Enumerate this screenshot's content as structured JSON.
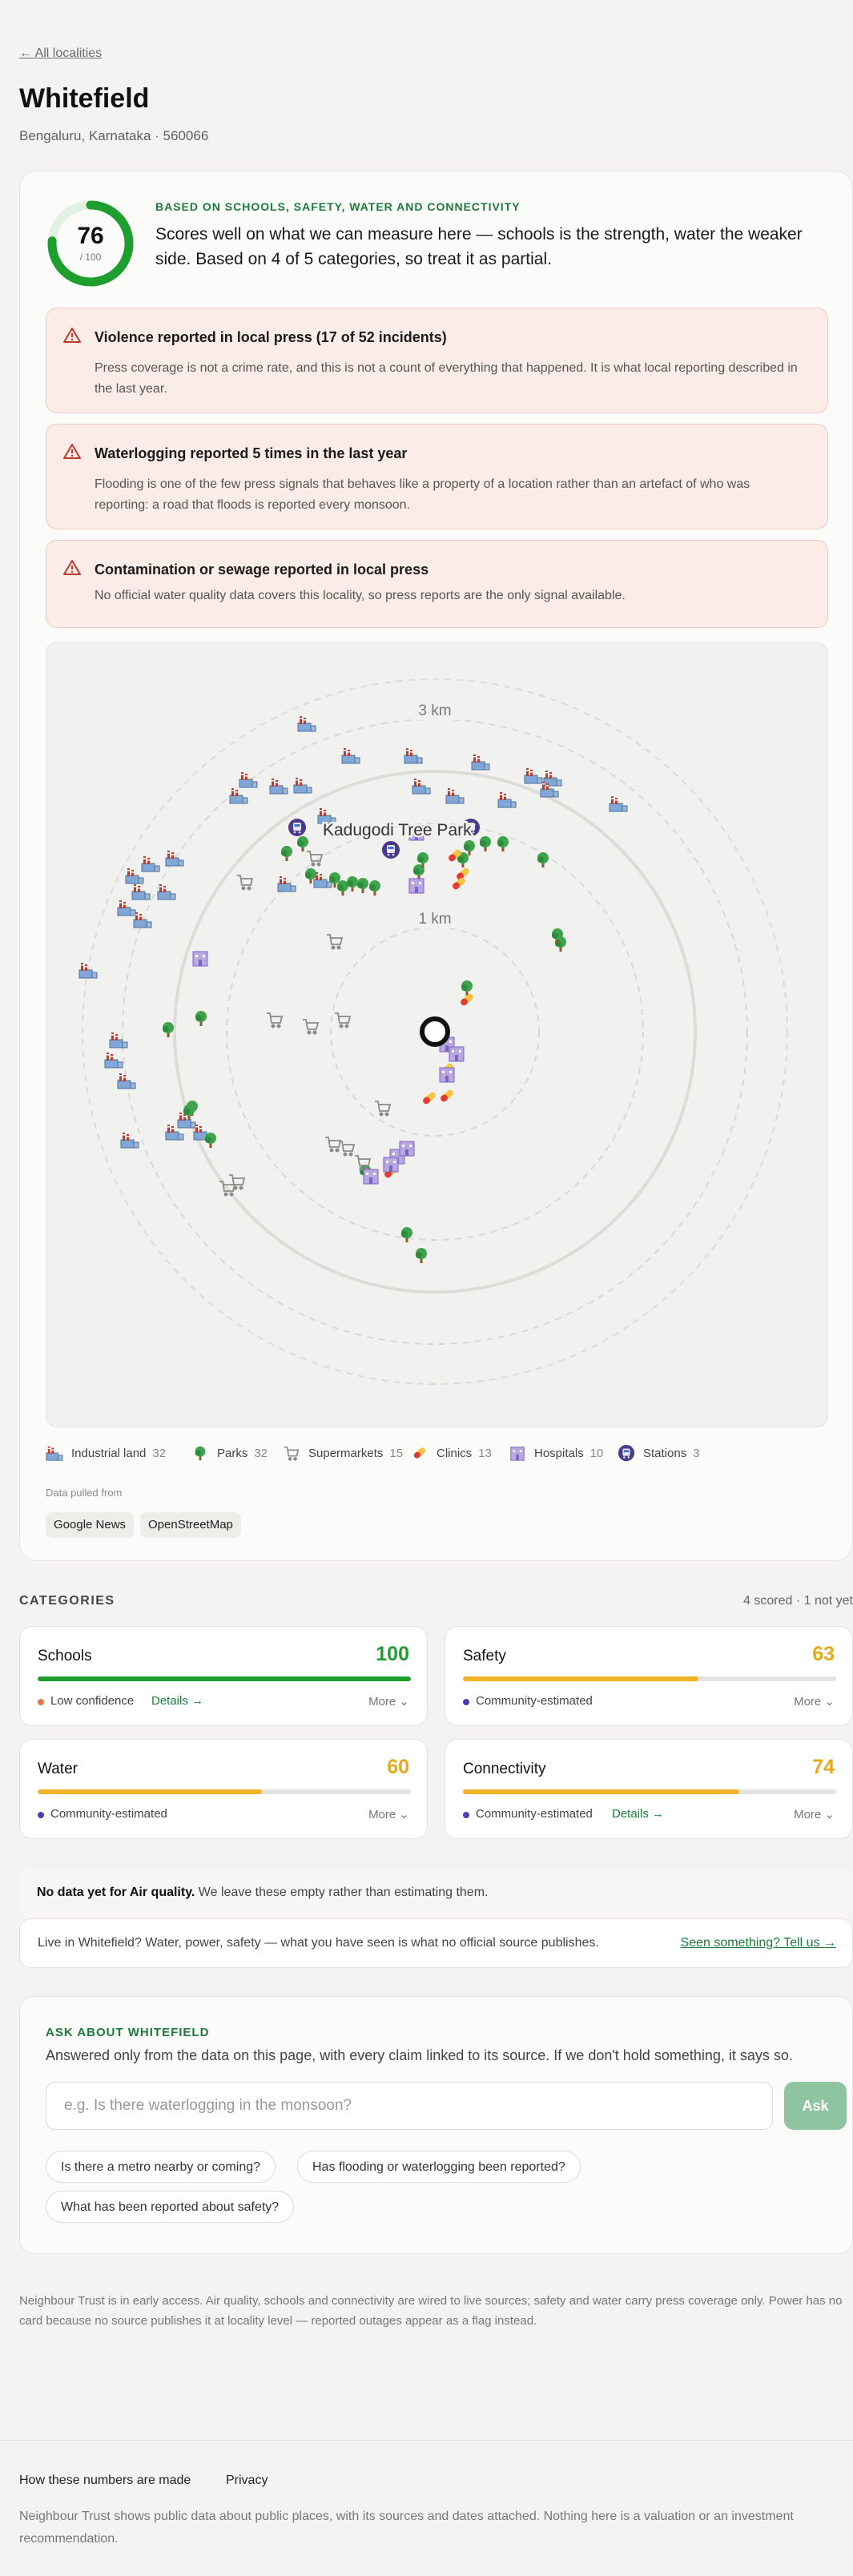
{
  "nav": {
    "back_label": "← All localities"
  },
  "locality": {
    "name": "Whitefield",
    "location": "Bengaluru, Karnataka · 560066"
  },
  "score": {
    "value": "76",
    "out_of": "/ 100",
    "fraction": 0.76,
    "ring_color": "#1e9e2e",
    "basis_label": "BASED ON SCHOOLS, SAFETY, WATER AND CONNECTIVITY",
    "summary": "Scores well on what we can measure here — schools is the strength, water the weaker side. Based on 4 of 5 categories, so treat it as partial."
  },
  "alerts": [
    {
      "title": "Violence reported in local press (17 of 52 incidents)",
      "body": "Press coverage is not a crime rate, and this is not a count of everything that happened. It is what local reporting described in the last year."
    },
    {
      "title": "Waterlogging reported 5 times in the last year",
      "body": "Flooding is one of the few press signals that behaves like a property of a location rather than an artefact of who was reporting: a road that floods is reported every monsoon."
    },
    {
      "title": "Contamination or sewage reported in local press",
      "body": "No official water quality data covers this locality, so press reports are the only signal available."
    }
  ],
  "map": {
    "ring_labels": [
      "1 km",
      "3 km"
    ],
    "highlight_label": "Kadugodi Tree Park"
  },
  "legend": [
    {
      "label": "Industrial land",
      "count": "32",
      "icon": "factory-icon"
    },
    {
      "label": "Parks",
      "count": "32",
      "icon": "tree-icon"
    },
    {
      "label": "Supermarkets",
      "count": "15",
      "icon": "cart-icon"
    },
    {
      "label": "Clinics",
      "count": "13",
      "icon": "pill-icon"
    },
    {
      "label": "Hospitals",
      "count": "10",
      "icon": "hospital-icon"
    },
    {
      "label": "Stations",
      "count": "3",
      "icon": "station-icon"
    }
  ],
  "sources": {
    "label": "Data pulled from",
    "items": [
      "Google News",
      "OpenStreetMap"
    ]
  },
  "categories": {
    "heading": "CATEGORIES",
    "summary": "4 scored · 1 not yet",
    "items": [
      {
        "name": "Schools",
        "score": "100",
        "fraction": 1.0,
        "color": "#1e9e2e",
        "confidence": "Low confidence",
        "dot_color": "#e07a4f",
        "details": "Details →",
        "more": "More ⌄"
      },
      {
        "name": "Safety",
        "score": "63",
        "fraction": 0.63,
        "color": "#f0b429",
        "confidence": "Community-estimated",
        "dot_color": "#4a3fb5",
        "details": "",
        "more": "More ⌄"
      },
      {
        "name": "Water",
        "score": "60",
        "fraction": 0.6,
        "color": "#f0b429",
        "confidence": "Community-estimated",
        "dot_color": "#4a3fb5",
        "details": "",
        "more": "More ⌄"
      },
      {
        "name": "Connectivity",
        "score": "74",
        "fraction": 0.74,
        "color": "#f0b429",
        "confidence": "Community-estimated",
        "dot_color": "#4a3fb5",
        "details": "Details →",
        "more": "More ⌄"
      }
    ]
  },
  "no_data": {
    "bold": "No data yet for Air quality.",
    "rest": " We leave these empty rather than estimating them."
  },
  "live": {
    "text": "Live in Whitefield? Water, power, safety — what you have seen is what no official source publishes.",
    "link": "Seen something? Tell us →"
  },
  "ask": {
    "heading": "ASK ABOUT WHITEFIELD",
    "sub": "Answered only from the data on this page, with every claim linked to its source. If we don't hold something, it says so.",
    "placeholder": "e.g. Is there waterlogging in the monsoon?",
    "button": "Ask",
    "suggestions": [
      "Is there a metro nearby or coming?",
      "Has flooding or waterlogging been reported?",
      "What has been reported about safety?"
    ]
  },
  "note": "Neighbour Trust is in early access. Air quality, schools and connectivity are wired to live sources; safety and water carry press coverage only. Power has no card because no source publishes it at locality level — reported outages appear as a flag instead.",
  "footer": {
    "links": [
      "How these numbers are made",
      "Privacy"
    ],
    "text": "Neighbour Trust shows public data about public places, with its sources and dates attached. Nothing here is a valuation or an investment recommendation."
  }
}
